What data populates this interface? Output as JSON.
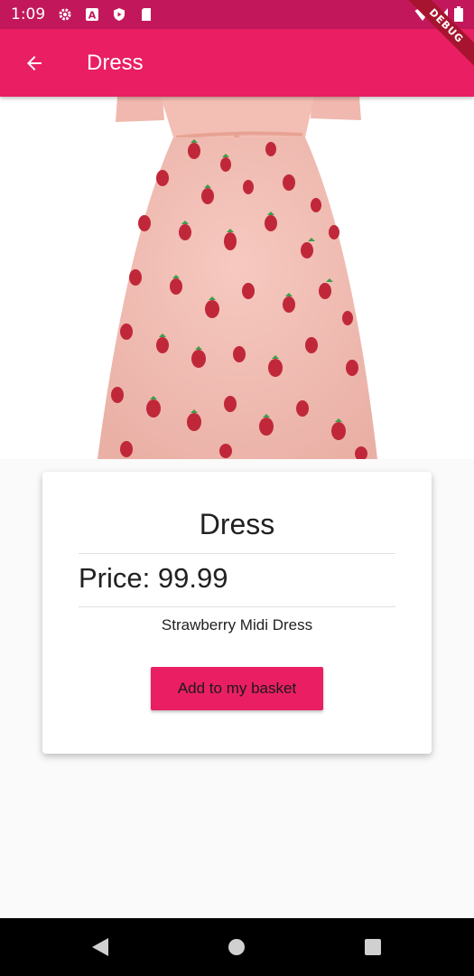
{
  "status_bar": {
    "time": "1:09",
    "icons": [
      "gear-icon",
      "font-a-icon",
      "shield-play-icon",
      "sd-card-icon"
    ],
    "right_icons": [
      "wifi-icon",
      "signal-icon",
      "battery-icon"
    ]
  },
  "app_bar": {
    "title": "Dress",
    "back_icon": "arrow-back-icon",
    "color": "#e91e63"
  },
  "debug_banner": "DEBUG",
  "product": {
    "image_icon": "strawberry-dress-image",
    "title": "Dress",
    "price": "Price: 99.99",
    "description": "Strawberry Midi Dress",
    "button_label": "Add to my basket"
  },
  "nav_bar": {
    "buttons": [
      "back-triangle-icon",
      "home-circle-icon",
      "recents-square-icon"
    ]
  },
  "colors": {
    "primary": "#e91e63",
    "primary_dark": "#c2185b",
    "background": "#fafafa"
  }
}
